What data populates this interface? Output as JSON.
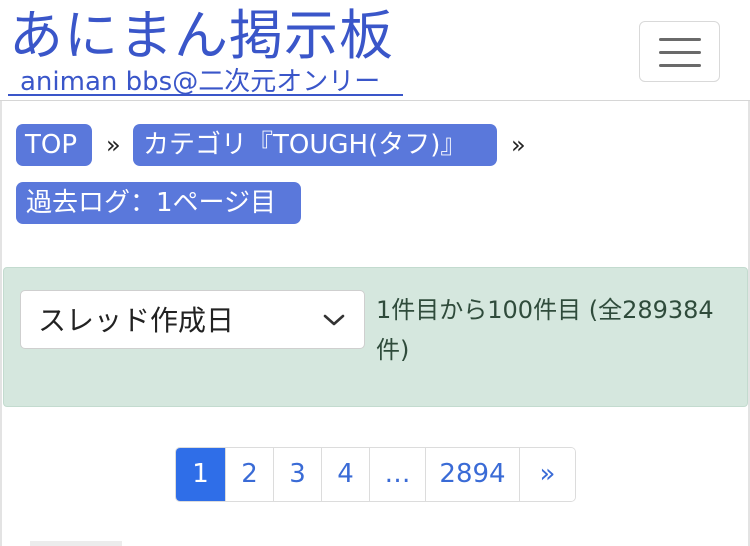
{
  "header": {
    "title": "あにまん掲示板",
    "subtitle": "animan bbs@二次元オンリー",
    "menu_icon": "hamburger-icon"
  },
  "breadcrumbs": {
    "items": [
      {
        "label": "TOP"
      },
      {
        "label": "カテゴリ『TOUGH(タフ)』"
      },
      {
        "label": "過去ログ：1ページ目"
      }
    ],
    "separator": "»"
  },
  "sort": {
    "selected": "スレッド作成日",
    "icon": "chevron-down-icon"
  },
  "range": {
    "text": "1件目から100件目 (全289384件)"
  },
  "pagination": {
    "pages": [
      "1",
      "2",
      "3",
      "4",
      "…",
      "2894",
      "»"
    ],
    "active": "1"
  },
  "colors": {
    "brand": "#3a56c9",
    "crumb_bg": "#5a78db",
    "panel_bg": "#d5e7de",
    "active_page": "#2f6ee8"
  }
}
